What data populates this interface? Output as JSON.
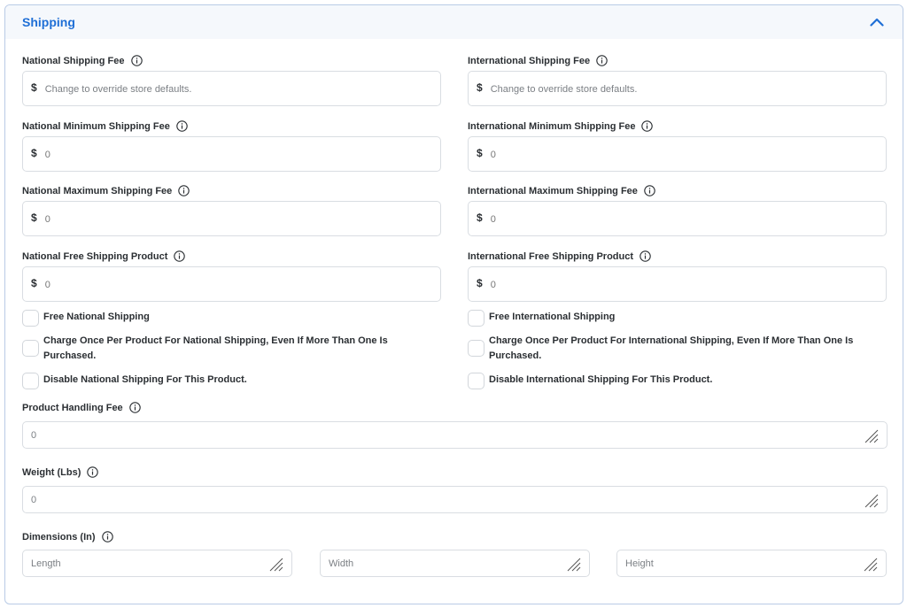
{
  "section": {
    "title": "Shipping",
    "collapse_icon": "chevron-up-icon"
  },
  "colors": {
    "accent": "#1f6fd6",
    "border": "#b9cbe6",
    "header_bg": "#f5f8fc"
  },
  "national": {
    "fee": {
      "label": "National Shipping Fee",
      "currency": "$",
      "placeholder": "Change to override store defaults."
    },
    "min_fee": {
      "label": "National Minimum Shipping Fee",
      "currency": "$",
      "value": "0"
    },
    "max_fee": {
      "label": "National Maximum Shipping Fee",
      "currency": "$",
      "value": "0"
    },
    "free_product": {
      "label": "National Free Shipping Product",
      "currency": "$",
      "value": "0"
    },
    "checks": [
      "Free National Shipping",
      "Charge Once Per Product For National Shipping, Even If More Than One Is Purchased.",
      "Disable National Shipping For This Product."
    ]
  },
  "international": {
    "fee": {
      "label": "International Shipping Fee",
      "currency": "$",
      "placeholder": "Change to override store defaults."
    },
    "min_fee": {
      "label": "International Minimum Shipping Fee",
      "currency": "$",
      "value": "0"
    },
    "max_fee": {
      "label": "International Maximum Shipping Fee",
      "currency": "$",
      "value": "0"
    },
    "free_product": {
      "label": "International Free Shipping Product",
      "currency": "$",
      "value": "0"
    },
    "checks": [
      "Free International Shipping",
      "Charge Once Per Product For International Shipping, Even If More Than One Is Purchased.",
      "Disable International Shipping For This Product."
    ]
  },
  "handling": {
    "label": "Product Handling Fee",
    "value": "0"
  },
  "weight": {
    "label": "Weight (Lbs)",
    "value": "0"
  },
  "dimensions": {
    "label": "Dimensions (In)",
    "length_placeholder": "Length",
    "width_placeholder": "Width",
    "height_placeholder": "Height"
  }
}
